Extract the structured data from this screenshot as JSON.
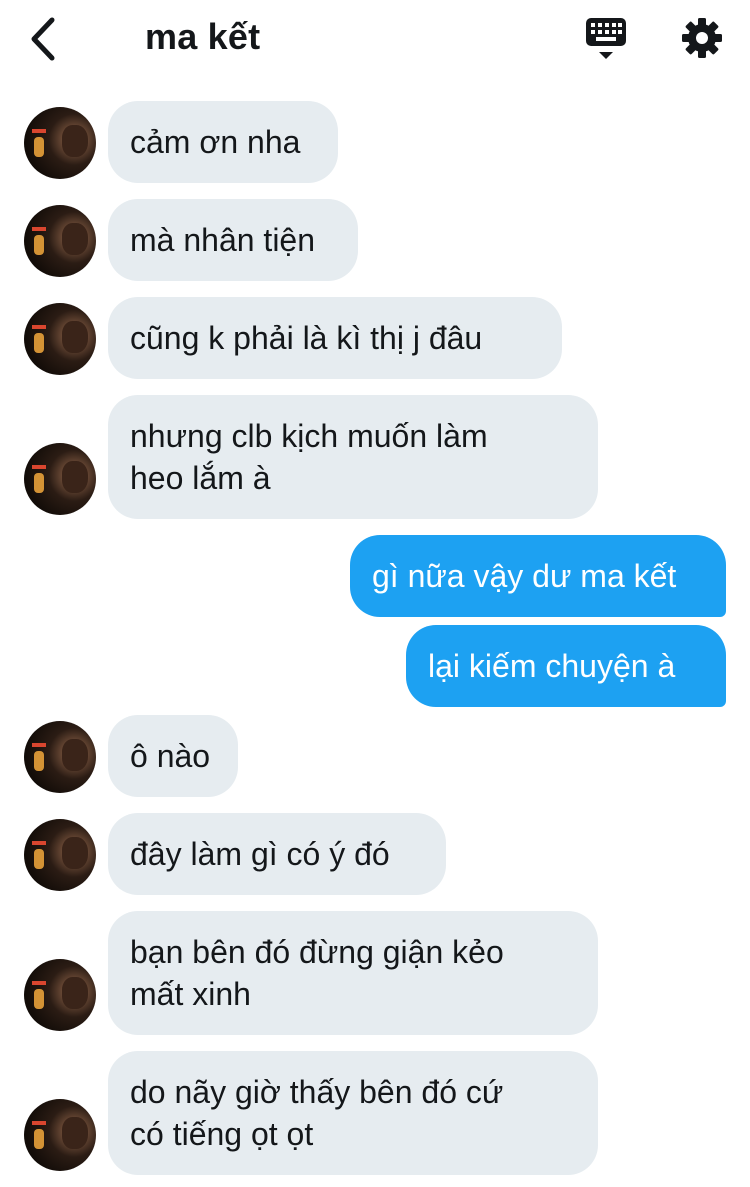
{
  "header": {
    "title": "ma kết"
  },
  "icons": {
    "back": "chevron-left-icon",
    "keyboard": "keyboard-icon",
    "settings": "gear-icon"
  },
  "colors": {
    "incoming_bubble": "#e6ecf0",
    "outgoing_bubble": "#1da1f2",
    "text": "#14171a"
  },
  "messages": [
    {
      "from": "them",
      "lines": [
        "cảm ơn nha"
      ]
    },
    {
      "from": "them",
      "lines": [
        "mà nhân tiện"
      ]
    },
    {
      "from": "them",
      "lines": [
        "cũng k phải là kì thị j đâu"
      ]
    },
    {
      "from": "them",
      "lines": [
        "nhưng clb kịch muốn làm",
        "heo lắm à"
      ]
    },
    {
      "from": "me",
      "lines": [
        "gì nữa vậy dư ma kết"
      ]
    },
    {
      "from": "me",
      "lines": [
        "lại kiếm chuyện à"
      ]
    },
    {
      "from": "them",
      "lines": [
        "ô nào"
      ]
    },
    {
      "from": "them",
      "lines": [
        "đây làm gì có ý đó"
      ]
    },
    {
      "from": "them",
      "lines": [
        "bạn bên đó đừng giận kẻo",
        "mất xinh"
      ]
    },
    {
      "from": "them",
      "lines": [
        "do nãy giờ thấy bên đó cứ",
        "có tiếng ọt ọt"
      ]
    }
  ]
}
